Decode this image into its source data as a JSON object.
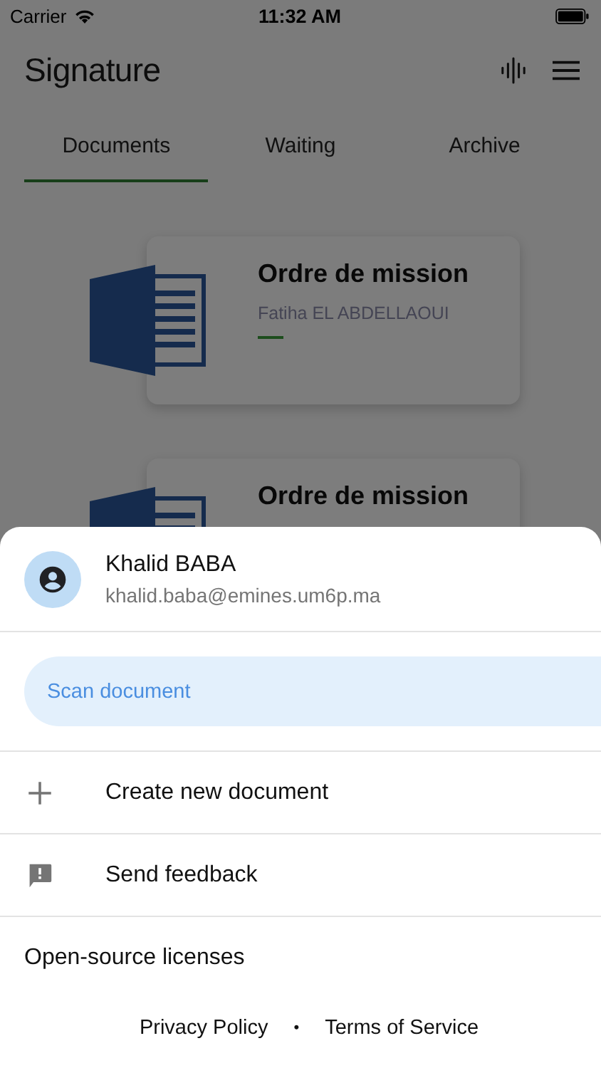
{
  "status_bar": {
    "carrier": "Carrier",
    "time": "11:32 AM"
  },
  "app_bar": {
    "title": "Signature"
  },
  "tabs": [
    {
      "label": "Documents",
      "selected": true
    },
    {
      "label": "Waiting",
      "selected": false
    },
    {
      "label": "Archive",
      "selected": false
    }
  ],
  "documents": [
    {
      "title": "Ordre de mission",
      "author": "Fatiha EL ABDELLAOUI"
    },
    {
      "title": "Ordre de mission"
    }
  ],
  "sheet": {
    "account": {
      "name": "Khalid BABA",
      "email": "khalid.baba@emines.um6p.ma"
    },
    "scan_button": "Scan document",
    "menu": [
      {
        "kind": "add",
        "label": "Create new document"
      },
      {
        "kind": "feedback",
        "label": "Send feedback"
      }
    ],
    "licenses": "Open-source licenses",
    "footer_links": [
      "Privacy Policy",
      "Terms of Service"
    ],
    "footer_separator": "•"
  }
}
